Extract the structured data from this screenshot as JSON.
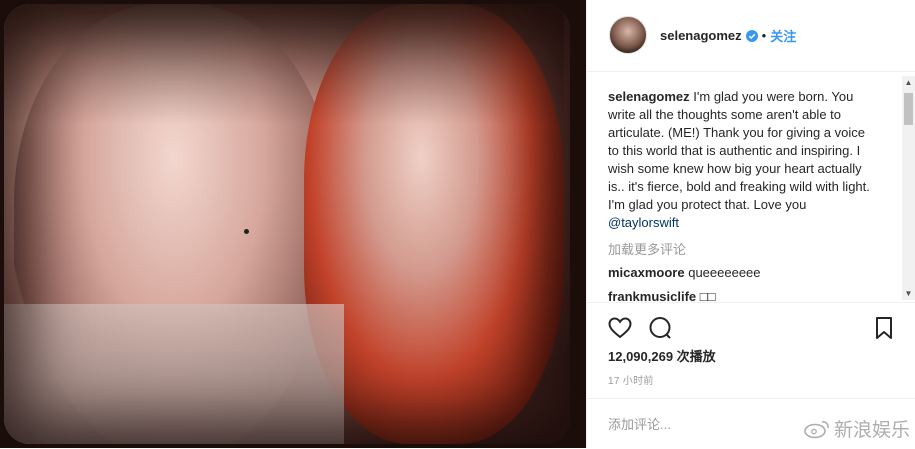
{
  "post": {
    "username": "selenagomez",
    "follow_label": "关注",
    "separator": "•"
  },
  "caption": {
    "username": "selenagomez",
    "text": "I'm glad you were born. You write all the thoughts some aren't able to articulate. (ME!) Thank you for giving a voice to this world that is authentic and inspiring. I wish some knew how big your heart actually is.. it's fierce, bold and freaking wild with light. I'm glad you protect that. Love you ",
    "mention": "@taylorswift"
  },
  "load_more_label": "加载更多评论",
  "comments": [
    {
      "user": "micaxmoore",
      "text": "queeeeeeee"
    },
    {
      "user": "frankmusiclife",
      "text": "□□"
    }
  ],
  "stats": {
    "views": "12,090,269 次播放",
    "time": "17 小时前"
  },
  "add_comment_placeholder": "添加评论...",
  "watermark": "新浪娱乐",
  "icons": {
    "verified": "verified-badge-icon",
    "like": "heart-icon",
    "comment": "comment-bubble-icon",
    "save": "bookmark-icon"
  },
  "colors": {
    "link": "#3897f0",
    "mention": "#003569",
    "text": "#262626",
    "muted": "#999999"
  }
}
